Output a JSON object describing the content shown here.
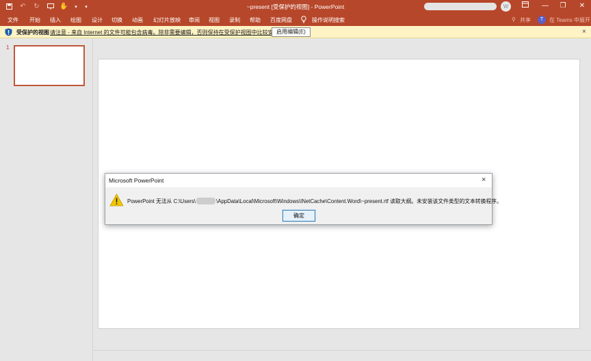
{
  "window": {
    "title": "~present [受保护的视图] - PowerPoint",
    "avatar_initial": "W"
  },
  "ribbon": {
    "tabs": [
      {
        "label": "文件"
      },
      {
        "label": "开始"
      },
      {
        "label": "插入"
      },
      {
        "label": "绘图"
      },
      {
        "label": "设计"
      },
      {
        "label": "切换"
      },
      {
        "label": "动画"
      },
      {
        "label": "幻灯片放映"
      },
      {
        "label": "审阅"
      },
      {
        "label": "视图"
      },
      {
        "label": "录制"
      },
      {
        "label": "帮助"
      },
      {
        "label": "百度网盘"
      }
    ],
    "tell_me": "操作说明搜索",
    "share": "共享",
    "teams": "在 Teams 中展开"
  },
  "protected_view": {
    "label": "受保护的视图",
    "message": "请注意 - 来自 Internet 的文件可能包含病毒。除非需要编辑，否则保持在受保护视图中比较安全。",
    "enable_button": "启用编辑(E)",
    "close": "×"
  },
  "slides": {
    "current_number": "1"
  },
  "dialog": {
    "title": "Microsoft PowerPoint",
    "message_start": "PowerPoint 无法从 C:\\Users\\",
    "message_end": "\\AppData\\Local\\Microsoft\\Windows\\INetCache\\Content.Word\\~present.rtf 读取大纲。未安装该文件类型的文本转换程序。",
    "ok_button": "确定",
    "close": "×"
  },
  "colors": {
    "accent": "#b7472a",
    "infobar": "#fdf3c5",
    "shield": "#1f5fa8",
    "warning": "#f2c500"
  }
}
